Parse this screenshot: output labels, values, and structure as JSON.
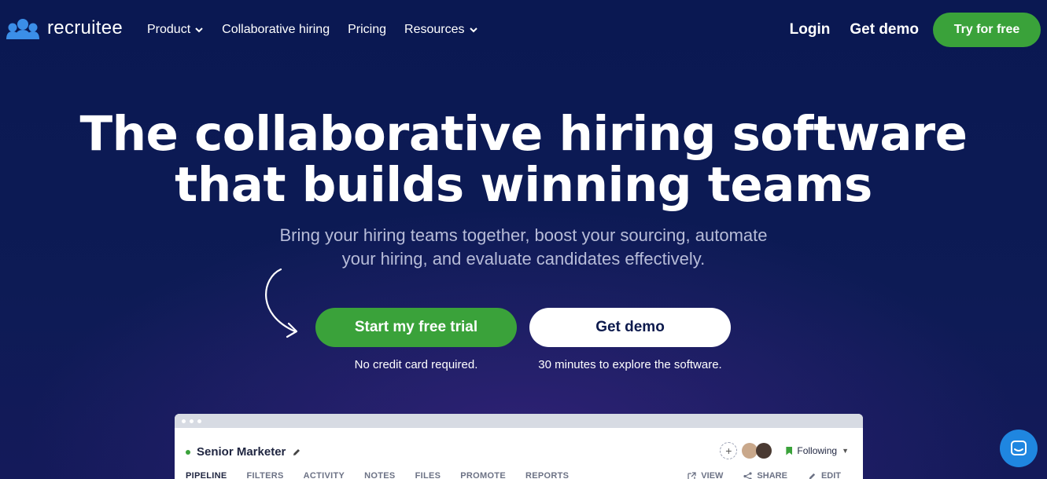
{
  "brand": {
    "name": "recruitee"
  },
  "nav": {
    "items": [
      {
        "label": "Product",
        "dropdown": true
      },
      {
        "label": "Collaborative hiring",
        "dropdown": false
      },
      {
        "label": "Pricing",
        "dropdown": false
      },
      {
        "label": "Resources",
        "dropdown": true
      }
    ],
    "login": "Login",
    "get_demo": "Get demo",
    "try_free": "Try for free"
  },
  "hero": {
    "title_line1": "The collaborative hiring software",
    "title_line2": "that builds winning teams",
    "subtitle_line1": "Bring your hiring teams together, boost your sourcing, automate",
    "subtitle_line2": "your hiring, and evaluate candidates effectively.",
    "cta_primary": "Start my free trial",
    "cta_secondary": "Get demo",
    "note_primary": "No credit card required.",
    "note_secondary": "30 minutes to explore the software."
  },
  "app_preview": {
    "job_title": "Senior Marketer",
    "tabs": [
      "PIPELINE",
      "FILTERS",
      "ACTIVITY",
      "NOTES",
      "FILES",
      "PROMOTE",
      "REPORTS"
    ],
    "following": "Following",
    "actions": [
      "VIEW",
      "SHARE",
      "EDIT"
    ]
  },
  "colors": {
    "accent_green": "#3aa23a",
    "background": "#0f1b53",
    "chat_blue": "#1f86e0"
  },
  "icons": [
    "logo-people-icon",
    "chevron-down-icon",
    "curved-arrow-icon",
    "pencil-icon",
    "plus-icon",
    "bookmark-icon",
    "external-link-icon",
    "share-icon",
    "chat-icon"
  ]
}
